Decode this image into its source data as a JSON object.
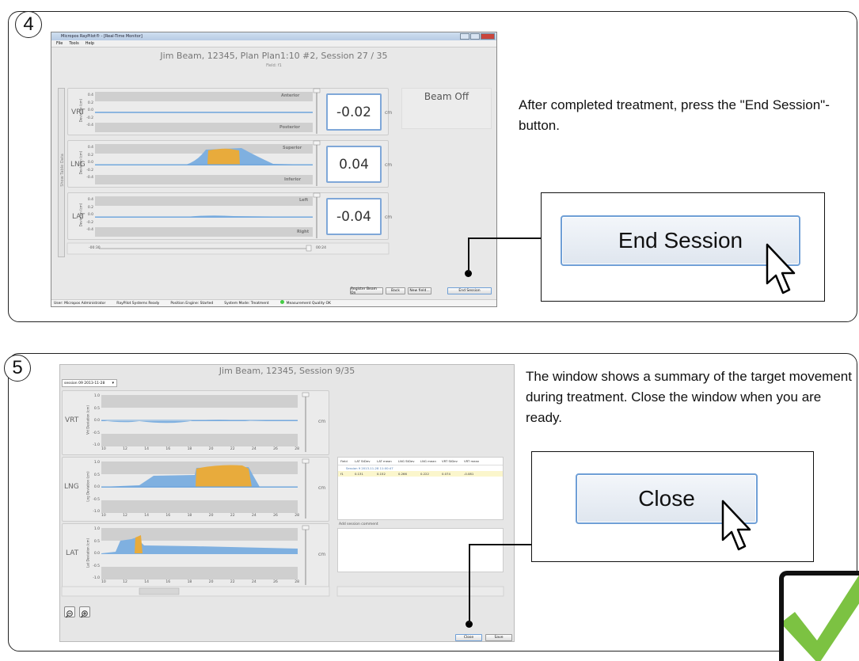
{
  "step4": {
    "number": "4",
    "window_title": "Micropos RayPilot® - [Real-Time Monitor]",
    "menu": [
      "File",
      "Tools",
      "Help"
    ],
    "header": "Jim Beam, 12345, Plan Plan1:10 #2, Session 27 / 35",
    "field": "Field: f1",
    "side_tab": "Show Table Data",
    "y_axis_label": "Deviation (cm)",
    "y_ticks": [
      "0.4",
      "0.2",
      "0.0",
      "-0.2",
      "-0.4"
    ],
    "unit": "cm",
    "rows": [
      {
        "label": "VRT",
        "readout": "-0.02",
        "top_dir": "Anterior",
        "bottom_dir": "Posterior"
      },
      {
        "label": "LNG",
        "readout": "0.04",
        "top_dir": "Superior",
        "bottom_dir": "Inferior"
      },
      {
        "label": "LAT",
        "readout": "-0.04",
        "top_dir": "Left",
        "bottom_dir": "Right"
      }
    ],
    "beam_status": "Beam Off",
    "slider_start": "-00:30",
    "slider_end": "00:24",
    "buttons": [
      "Register Beam On",
      "Back",
      "New field...",
      "End Session"
    ],
    "status_items": [
      "User: Micropos Administrator",
      "RayPilot Systems Ready",
      "Position Engine: Started",
      "System Mode: Treatment",
      "Measurement Quality OK"
    ],
    "instruction": "After completed treatment, press the \"End Session\"-button.",
    "callout_button": "End Session"
  },
  "step5": {
    "number": "5",
    "header": "Jim Beam, 12345, Session 9/35",
    "session_select": "session 09 2013-11-28",
    "y_axis_label": "Vrt Deviation (cm)",
    "y_axis_label_lng": "Lng Deviation (cm)",
    "y_axis_label_lat": "Lat Deviation (cm)",
    "y_ticks": [
      "1.0",
      "0.5",
      "0.0",
      "-0.5",
      "-1.0"
    ],
    "x_ticks": [
      "10",
      "12",
      "14",
      "16",
      "18",
      "20",
      "22",
      "24",
      "26",
      "28"
    ],
    "row_labels": [
      "VRT",
      "LNG",
      "LAT"
    ],
    "unit": "cm",
    "table": {
      "headers": [
        "Field",
        "LAT StDev",
        "LAT mean",
        "LNG StDev",
        "LNG mean",
        "VRT StDev",
        "VRT mean"
      ],
      "session_row": "Session 9 2013-11-28 11:00:47",
      "data_row": [
        "f1",
        "0.131",
        "0.152",
        "0.266",
        "0.222",
        "0.074",
        "-0.081"
      ]
    },
    "comment_label": "Add session comment",
    "buttons": [
      "Close",
      "Save"
    ],
    "zoom_out_icon": "zoom-out-icon",
    "zoom_in_icon": "zoom-in-icon",
    "instruction": "The window shows a summary of the target movement during treatment. Close the window when you are ready.",
    "callout_button": "Close"
  },
  "colors": {
    "orange": "#e8ab3c",
    "blue": "#7fb0e0",
    "check_green": "#7cc242",
    "button_border": "#6f9fd6"
  }
}
